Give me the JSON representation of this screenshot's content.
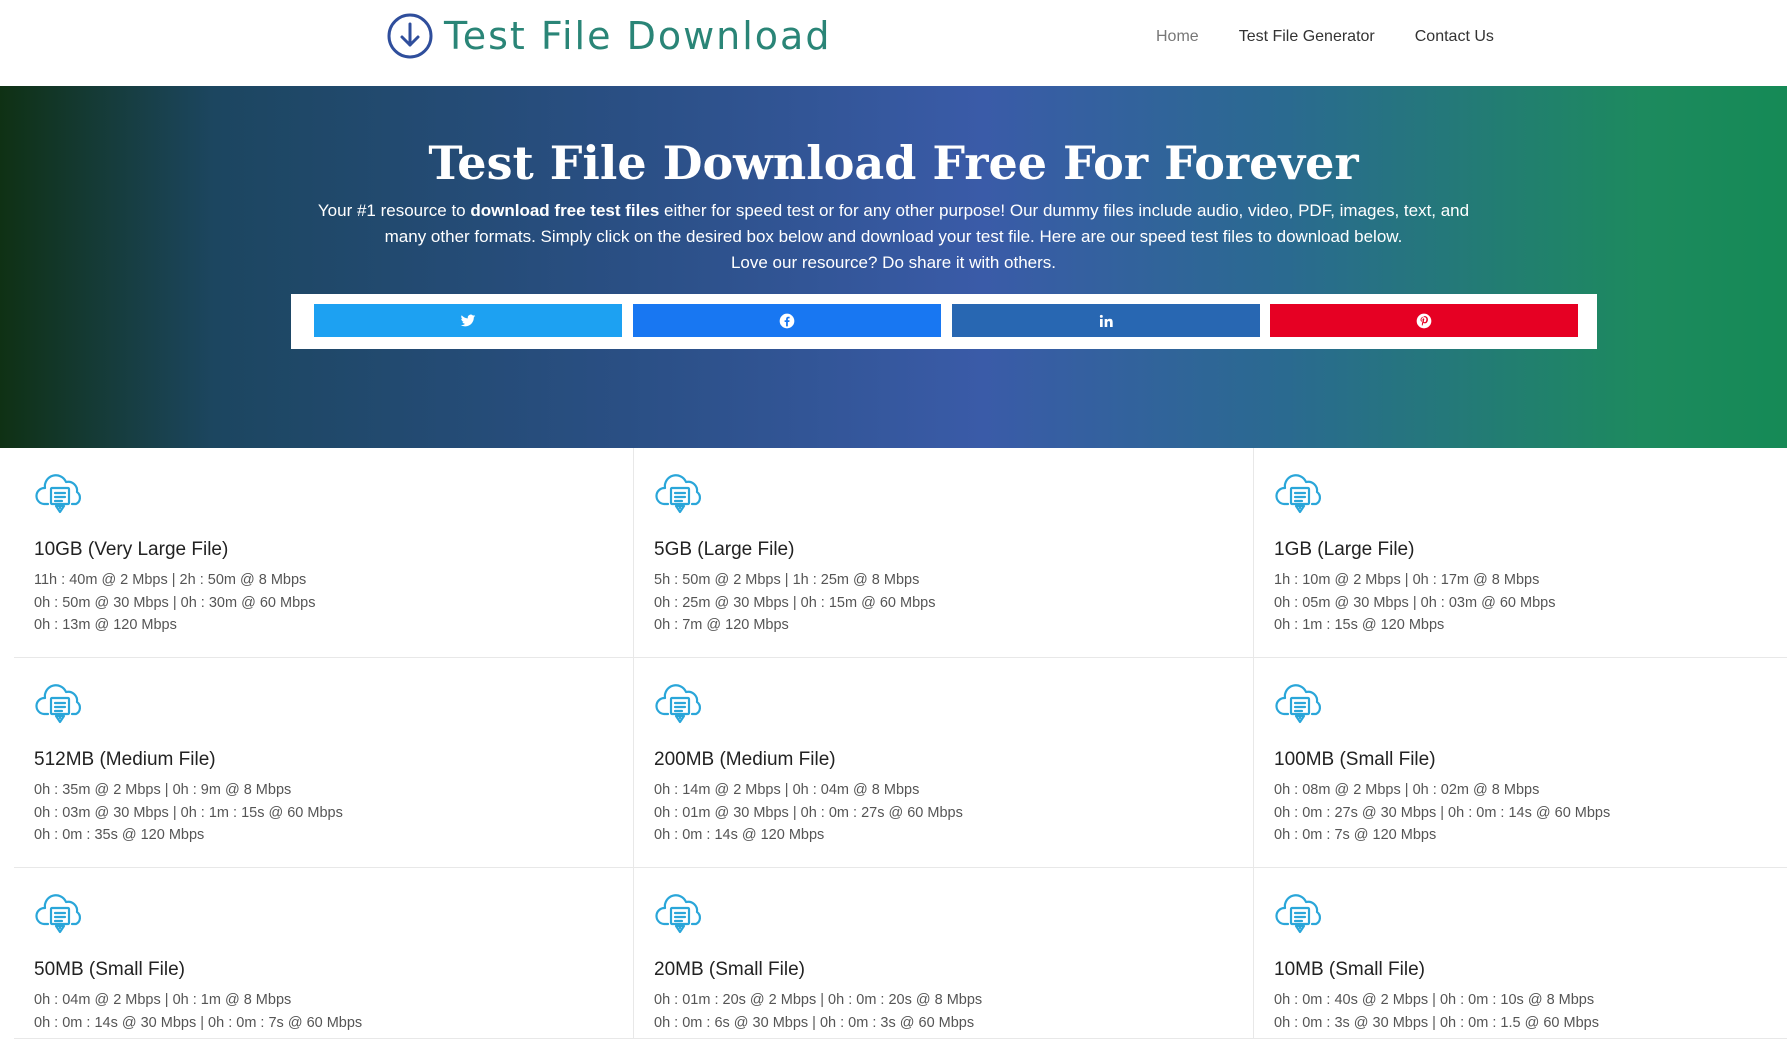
{
  "header": {
    "logo_text": "Test File Download",
    "nav": [
      "Home",
      "Test File Generator",
      "Contact Us"
    ]
  },
  "hero": {
    "title": "Test File Download Free For Forever",
    "text_prefix": "Your #1 resource to ",
    "text_bold": "download free test files",
    "text_suffix": " either for speed test or for any other purpose! Our dummy files include audio, video, PDF, images, text, and many other formats. Simply click on the desired box below and download your test file. Here are our speed test files to download below.",
    "love_text": "Love our resource? Do share it with others."
  },
  "share": [
    {
      "name": "twitter",
      "icon": "twitter-icon",
      "color": "#1da1f2"
    },
    {
      "name": "facebook",
      "icon": "facebook-icon",
      "color": "#1877f2"
    },
    {
      "name": "linkedin",
      "icon": "linkedin-icon",
      "color": "#2867b2"
    },
    {
      "name": "pinterest",
      "icon": "pinterest-icon",
      "color": "#e60023"
    }
  ],
  "files": [
    {
      "title": "10GB (Very Large File)",
      "lines": [
        "11h : 40m @ 2 Mbps | 2h : 50m @ 8 Mbps",
        "0h : 50m @ 30 Mbps | 0h : 30m @ 60 Mbps",
        "0h : 13m @ 120 Mbps"
      ]
    },
    {
      "title": "5GB (Large File)",
      "lines": [
        "5h : 50m @ 2 Mbps | 1h : 25m @ 8 Mbps",
        "0h : 25m @ 30 Mbps | 0h : 15m @ 60 Mbps",
        "0h : 7m @ 120 Mbps"
      ]
    },
    {
      "title": "1GB (Large File)",
      "lines": [
        "1h : 10m @ 2 Mbps | 0h : 17m @ 8 Mbps",
        "0h : 05m @ 30 Mbps | 0h : 03m @ 60 Mbps",
        "0h : 1m : 15s @ 120 Mbps"
      ]
    },
    {
      "title": "512MB (Medium File)",
      "lines": [
        "0h : 35m @ 2 Mbps | 0h : 9m @ 8 Mbps",
        "0h : 03m @ 30 Mbps | 0h : 1m : 15s @ 60 Mbps",
        "0h : 0m : 35s @ 120 Mbps"
      ]
    },
    {
      "title": "200MB (Medium File)",
      "lines": [
        "0h : 14m @ 2 Mbps | 0h : 04m @ 8 Mbps",
        "0h : 01m @ 30 Mbps | 0h : 0m : 27s @ 60 Mbps",
        "0h : 0m : 14s @ 120 Mbps"
      ]
    },
    {
      "title": "100MB (Small File)",
      "lines": [
        "0h : 08m @ 2 Mbps | 0h : 02m @ 8 Mbps",
        "0h : 0m : 27s @ 30 Mbps | 0h : 0m : 14s @ 60 Mbps",
        "0h : 0m : 7s @ 120 Mbps"
      ]
    },
    {
      "title": "50MB (Small File)",
      "lines": [
        "0h : 04m @ 2 Mbps | 0h : 1m @ 8 Mbps",
        "0h : 0m : 14s @ 30 Mbps | 0h : 0m : 7s @ 60 Mbps",
        ""
      ]
    },
    {
      "title": "20MB (Small File)",
      "lines": [
        "0h : 01m : 20s @ 2 Mbps | 0h : 0m : 20s @ 8 Mbps",
        "0h : 0m : 6s @ 30 Mbps | 0h : 0m : 3s @ 60 Mbps",
        ""
      ]
    },
    {
      "title": "10MB (Small File)",
      "lines": [
        "0h : 0m : 40s @ 2 Mbps | 0h : 0m : 10s @ 8 Mbps",
        "0h : 0m : 3s @ 30 Mbps | 0h : 0m : 1.5 @ 60 Mbps",
        ""
      ]
    }
  ]
}
